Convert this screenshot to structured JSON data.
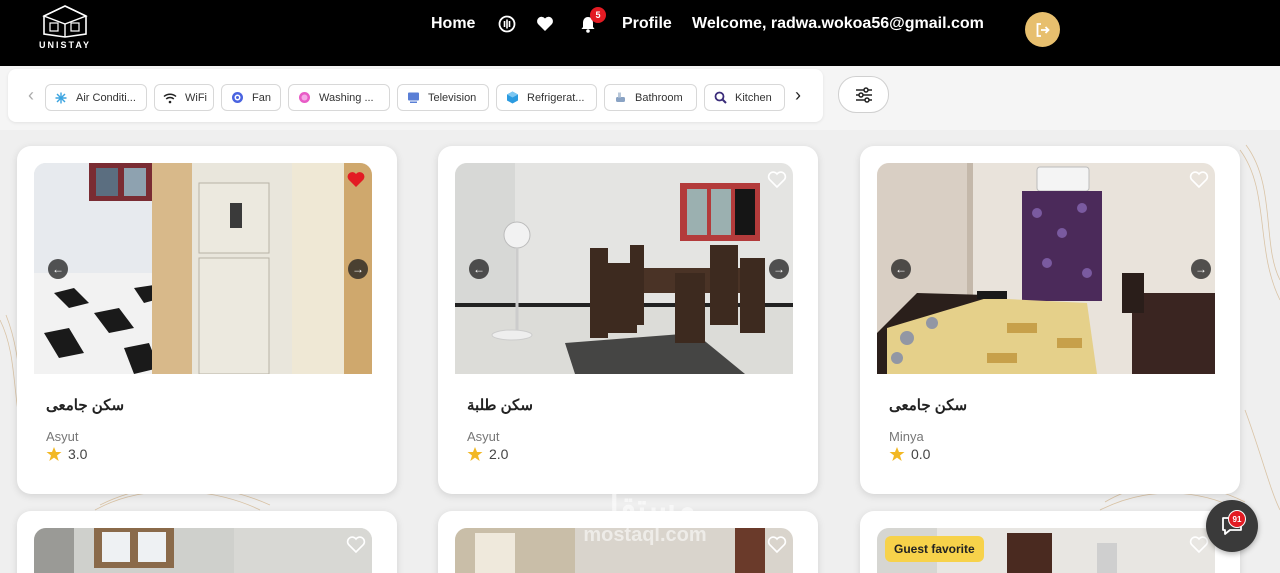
{
  "brand": {
    "name": "UNISTAY"
  },
  "header": {
    "home_label": "Home",
    "profile_label": "Profile",
    "welcome_text": "Welcome, radwa.wokoa56@gmail.com",
    "notification_count": "5",
    "icons": [
      "podcast-icon",
      "heart-icon",
      "bell-icon",
      "logout-icon"
    ]
  },
  "filters": {
    "prev_icon": "chevron-left-icon",
    "next_icon": "chevron-right-icon",
    "chips": [
      {
        "label": "Air Conditi...",
        "icon": "snowflake-icon"
      },
      {
        "label": "WiFi",
        "icon": "wifi-icon"
      },
      {
        "label": "Fan",
        "icon": "fan-icon"
      },
      {
        "label": "Washing ...",
        "icon": "washing-machine-icon"
      },
      {
        "label": "Television",
        "icon": "television-icon"
      },
      {
        "label": "Refrigerat...",
        "icon": "refrigerator-icon"
      },
      {
        "label": "Bathroom",
        "icon": "bathroom-icon"
      },
      {
        "label": "Kitchen",
        "icon": "kitchen-icon"
      }
    ],
    "settings_icon": "sliders-icon"
  },
  "listings": [
    {
      "title": "سكن جامعى",
      "city": "Asyut",
      "rating": "3.0",
      "favorite": true
    },
    {
      "title": "سكن طلبة",
      "city": "Asyut",
      "rating": "2.0",
      "favorite": false
    },
    {
      "title": "سكن جامعى",
      "city": "Minya",
      "rating": "0.0",
      "favorite": false
    }
  ],
  "second_row": [
    {
      "badge": ""
    },
    {
      "badge": ""
    },
    {
      "badge": "Guest favorite"
    }
  ],
  "chat": {
    "badge_count": "91"
  },
  "watermark": {
    "line1": "مستقل",
    "line2": "mostaql.com"
  },
  "colors": {
    "accent": "#e7bf6e",
    "header_bg": "#000000",
    "favorite": "#e31b23",
    "guest_badge": "#f7d24a"
  }
}
